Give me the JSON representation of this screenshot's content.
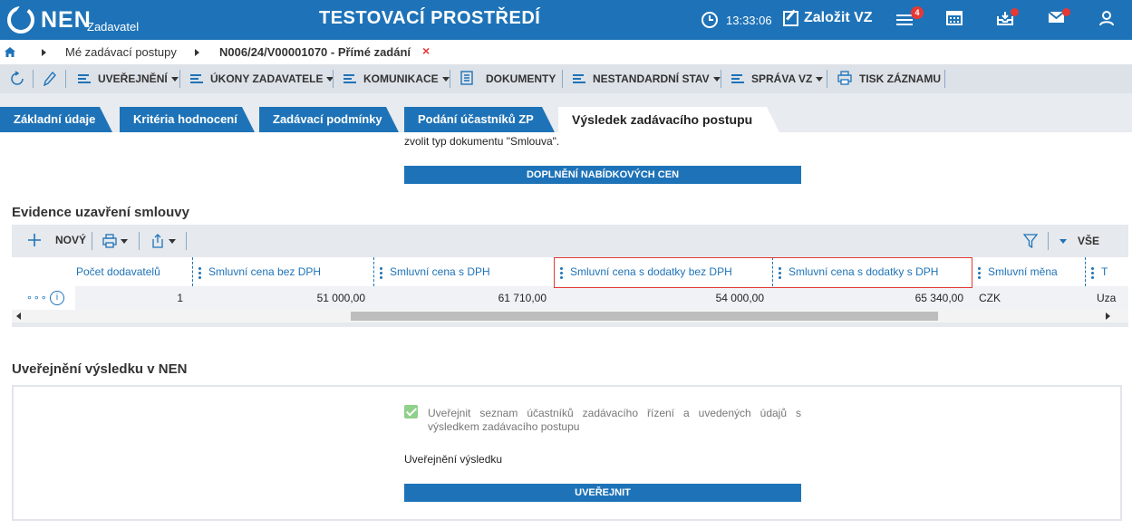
{
  "header": {
    "logo_text": "NEN",
    "logo_sub": "Zadavatel",
    "env_title": "TESTOVACÍ PROSTŘEDÍ",
    "time": "13:33:06",
    "create_label": "Založit VZ",
    "menu_badge": "4",
    "accent_color": "#1e73b8"
  },
  "breadcrumb": {
    "item1": "Mé zadávací postupy",
    "item2": "N006/24/V00001070 - Přímé zadání",
    "close": "×"
  },
  "toolbar": {
    "publish": "UVEŘEJNĚNÍ",
    "actions": "ÚKONY ZADAVATELE",
    "communication": "KOMUNIKACE",
    "documents": "DOKUMENTY",
    "nonstandard": "NESTANDARDNÍ STAV",
    "management": "SPRÁVA VZ",
    "print": "TISK ZÁZNAMU"
  },
  "tabs": [
    {
      "label": "Základní údaje"
    },
    {
      "label": "Kritéria hodnocení"
    },
    {
      "label": "Zadávací podmínky"
    },
    {
      "label": "Podání účastníků ZP"
    },
    {
      "label": "Výsledek zadávacího postupu"
    }
  ],
  "content": {
    "note": "zvolit typ dokumentu \"Smlouva\".",
    "supplement_btn": "DOPLNĚNÍ NABÍDKOVÝCH CEN",
    "contract_title": "Evidence uzavření smlouvy",
    "new_label": "NOVÝ",
    "filter_all": "VŠE",
    "columns": {
      "c1": "Počet dodavatelů",
      "c2": "Smluvní cena bez DPH",
      "c3": "Smluvní cena s DPH",
      "c4": "Smluvní cena s dodatky bez DPH",
      "c5": "Smluvní cena s dodatky s DPH",
      "c6": "Smluvní měna",
      "c7": "T"
    },
    "row": {
      "more": "∘∘∘",
      "info": "i",
      "c1": "1",
      "c2": "51 000,00",
      "c3": "61 710,00",
      "c4": "54 000,00",
      "c5": "65 340,00",
      "c6": "CZK",
      "c7": "Uza"
    },
    "publish_title": "Uveřejnění výsledku v NEN",
    "checkbox_text": "Uveřejnit seznam účastníků zadávacího řízení a uvedených údajů s výsledkem zadávacího postupu",
    "publish_label": "Uveřejnění výsledku",
    "publish_btn": "UVEŘEJNIT"
  }
}
